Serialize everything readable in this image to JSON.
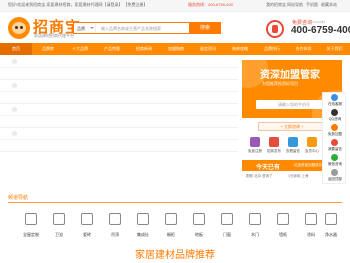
{
  "topbar": {
    "welcome": "您好!欢迎来到招商宝-家居建材招商，家居建材代理网【请登录】 【免费注册】",
    "hotline": "服务热线：400-6759-400",
    "links": [
      "我的招商宝",
      "网站导航",
      "手机版",
      "收藏本站"
    ]
  },
  "header": {
    "logo_text": "招商宝",
    "logo_sub": "家居建材招商代理平台",
    "search_scope": "品牌",
    "search_placeholder": "输入品牌名称或主营产品名称搜索",
    "search_button": "搜索",
    "free_call": "免费咨询",
    "free_call_sub": "7×24小时",
    "phone": "400-6759-400"
  },
  "nav": [
    "首页",
    "品牌库",
    "十大品牌",
    "产品特惠",
    "招商新闻",
    "加盟指南",
    "展会资讯",
    "装修攻略",
    "品牌排行",
    "合作伙伴",
    "关于我们"
  ],
  "promo": {
    "title": "资深加盟管家",
    "subtitle": "为您推荐投资好项目",
    "input_placeholder": "请输入您的手机号",
    "plus_label": "+ 立即咨询 +"
  },
  "services": [
    {
      "label": "免费注册",
      "color": "#9b59b6"
    },
    {
      "label": "招商发布",
      "color": "#e74c3c"
    },
    {
      "label": "查看留言",
      "color": "#3498db"
    },
    {
      "label": "会员中心",
      "color": "#f39c12"
    },
    {
      "label": "发布产品",
      "color": "#27ae60"
    }
  ],
  "banner": {
    "title": "今天已有",
    "subtitle": "位投资者加盟成功，咨询加盟"
  },
  "join_items": [
    "刚刚 北京 咨询了",
    "1分钟前 上海"
  ],
  "sidebar": [
    {
      "label": "在线客服",
      "color": "#3b8fe0"
    },
    {
      "label": "QQ咨询",
      "color": "#333333"
    },
    {
      "label": "免费加盟",
      "color": "#ff7a00"
    },
    {
      "label": "我要留言",
      "color": "#e84b3a"
    },
    {
      "label": "微信咨询",
      "color": "#2fae3a"
    },
    {
      "label": "返回顶部",
      "color": "#999999"
    }
  ],
  "hot": {
    "title": "频道导航",
    "categories": [
      "全屋定制",
      "卫浴",
      "瓷砖",
      "吊顶",
      "集成灶",
      "橱柜",
      "地板",
      "门窗",
      "木门",
      "墙纸",
      "涂料",
      "净水器"
    ]
  },
  "section_title": "家居建材品牌推荐"
}
